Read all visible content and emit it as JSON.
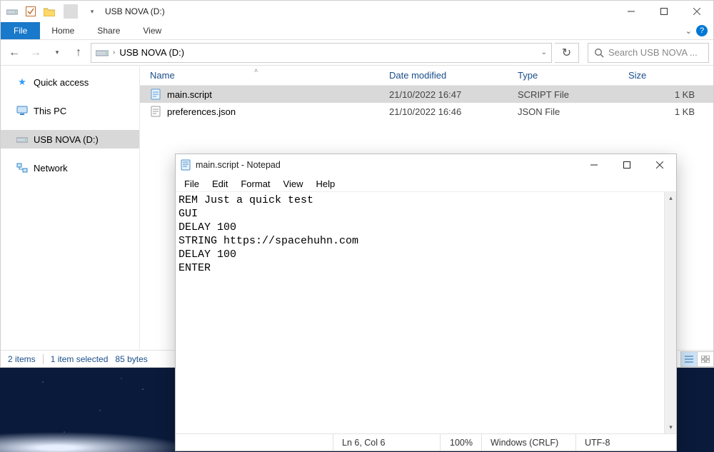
{
  "explorer": {
    "window_title": "USB NOVA (D:)",
    "ribbon": {
      "file": "File",
      "tabs": [
        "Home",
        "Share",
        "View"
      ]
    },
    "nav": {
      "breadcrumb": "USB NOVA (D:)",
      "search_placeholder": "Search USB NOVA ..."
    },
    "sidebar": {
      "items": [
        {
          "label": "Quick access",
          "icon": "star",
          "color": "#2e9cff"
        },
        {
          "label": "This PC",
          "icon": "pc",
          "color": "#3a88c9"
        },
        {
          "label": "USB NOVA (D:)",
          "icon": "drive",
          "color": "#6a6a6a",
          "selected": true
        },
        {
          "label": "Network",
          "icon": "net",
          "color": "#2f89c6"
        }
      ]
    },
    "columns": {
      "name": "Name",
      "date": "Date modified",
      "type": "Type",
      "size": "Size"
    },
    "rows": [
      {
        "name": "main.script",
        "date": "21/10/2022 16:47",
        "type": "SCRIPT File",
        "size": "1 KB",
        "icon": "script",
        "selected": true
      },
      {
        "name": "preferences.json",
        "date": "21/10/2022 16:46",
        "type": "JSON File",
        "size": "1 KB",
        "icon": "json"
      }
    ],
    "status": {
      "count": "2 items",
      "sel": "1 item selected",
      "bytes": "85 bytes"
    }
  },
  "notepad": {
    "title": "main.script - Notepad",
    "menu": [
      "File",
      "Edit",
      "Format",
      "View",
      "Help"
    ],
    "content": "REM Just a quick test\nGUI\nDELAY 100\nSTRING https://spacehuhn.com\nDELAY 100\nENTER",
    "status": {
      "caret": "Ln 6, Col 6",
      "zoom": "100%",
      "eol": "Windows (CRLF)",
      "enc": "UTF-8"
    }
  }
}
